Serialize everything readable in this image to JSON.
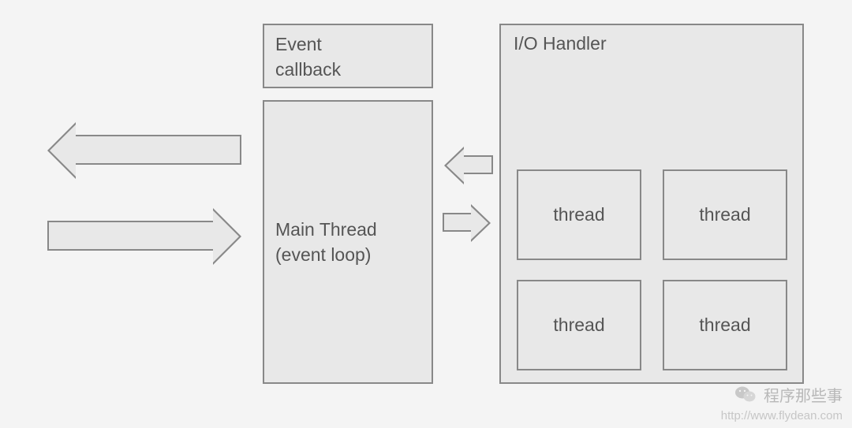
{
  "eventCallback": {
    "line1": "Event",
    "line2": "callback"
  },
  "mainThread": {
    "line1": "Main Thread",
    "line2": "(event loop)"
  },
  "ioHandler": {
    "title": "I/O Handler"
  },
  "threads": [
    "thread",
    "thread",
    "thread",
    "thread"
  ],
  "watermark": {
    "text": "程序那些事",
    "url": "http://www.flydean.com"
  }
}
